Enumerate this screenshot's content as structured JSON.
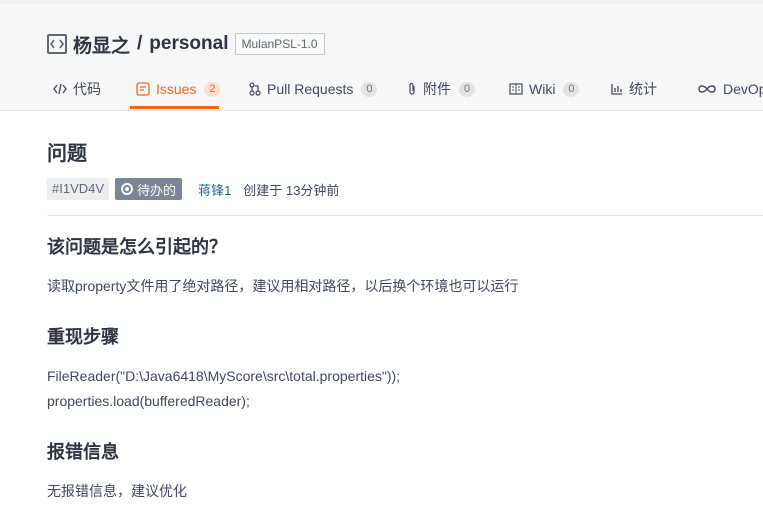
{
  "repo": {
    "owner": "杨显之",
    "separator": "/",
    "name": "personal",
    "license": "MulanPSL-1.0"
  },
  "tabs": [
    {
      "label": "代码",
      "icon": "code-icon"
    },
    {
      "label": "Issues",
      "count": "2",
      "icon": "issues-icon",
      "active": true
    },
    {
      "label": "Pull Requests",
      "count": "0",
      "icon": "pull-request-icon"
    },
    {
      "label": "附件",
      "count": "0",
      "icon": "paperclip-icon"
    },
    {
      "label": "Wiki",
      "count": "0",
      "icon": "book-icon"
    },
    {
      "label": "统计",
      "icon": "chart-icon"
    },
    {
      "label": "DevOps",
      "icon": "infinity-icon"
    }
  ],
  "issue": {
    "title": "问题",
    "id": "#I1VD4V",
    "status": "待办的",
    "author": "蒋锋1",
    "created": "创建于 13分钟前"
  },
  "body": {
    "cause_heading": "该问题是怎么引起的？",
    "cause_text": "读取property文件用了绝对路径，建议用相对路径，以后换个环境也可以运行",
    "steps_heading": "重现步骤",
    "steps_line1": "FileReader(\"D:\\Java6418\\MyScore\\src\\total.properties\"));",
    "steps_line2": "properties.load(bufferedReader);",
    "error_heading": "报错信息",
    "error_text": "无报错信息，建议优化"
  },
  "colors": {
    "accent": "#f26522",
    "status_bg": "#7b8596",
    "link": "#1e6c85"
  }
}
